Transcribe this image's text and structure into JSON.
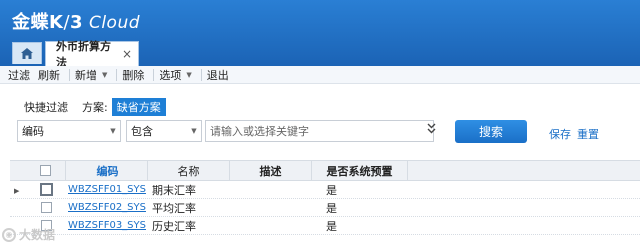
{
  "app": {
    "brand": "金蝶",
    "brand_k": "K",
    "brand_slash": "/",
    "brand_3": "3",
    "brand_cloud": " Cloud"
  },
  "tabs": {
    "home_icon": "home-icon",
    "active_label": "外币折算方法",
    "close_glyph": "×"
  },
  "toolbar": {
    "items": [
      {
        "label": "过滤"
      },
      {
        "label": "刷新"
      },
      {
        "label": "新增",
        "dropdown": true
      },
      {
        "label": "删除"
      },
      {
        "label": "选项",
        "dropdown": true
      },
      {
        "label": "退出"
      }
    ]
  },
  "quick_filter": {
    "label": "快捷过滤",
    "scheme_label": "方案:",
    "scheme_value": "缺省方案"
  },
  "filter": {
    "field_value": "编码",
    "operator_value": "包含",
    "keyword_placeholder": "请输入或选择关键字",
    "expand_icon": "double-chevron-down-icon",
    "search_label": "搜索",
    "save_label": "保存",
    "reset_label": "重置"
  },
  "grid": {
    "headers": {
      "code": "编码",
      "name": "名称",
      "desc": "描述",
      "is_system": "是否系统预置"
    },
    "rows": [
      {
        "code": "WBZSFF01_SYS",
        "name": "期末汇率",
        "desc": "",
        "is_system": "是",
        "current": true
      },
      {
        "code": "WBZSFF02_SYS",
        "name": "平均汇率",
        "desc": "",
        "is_system": "是",
        "current": false
      },
      {
        "code": "WBZSFF03_SYS",
        "name": "历史汇率",
        "desc": "",
        "is_system": "是",
        "current": false
      }
    ]
  },
  "watermark": {
    "text": "大数据"
  },
  "colors": {
    "header_blue": "#1b63b5",
    "accent_blue": "#1e7fd6",
    "link_blue": "#1a6fc7"
  }
}
